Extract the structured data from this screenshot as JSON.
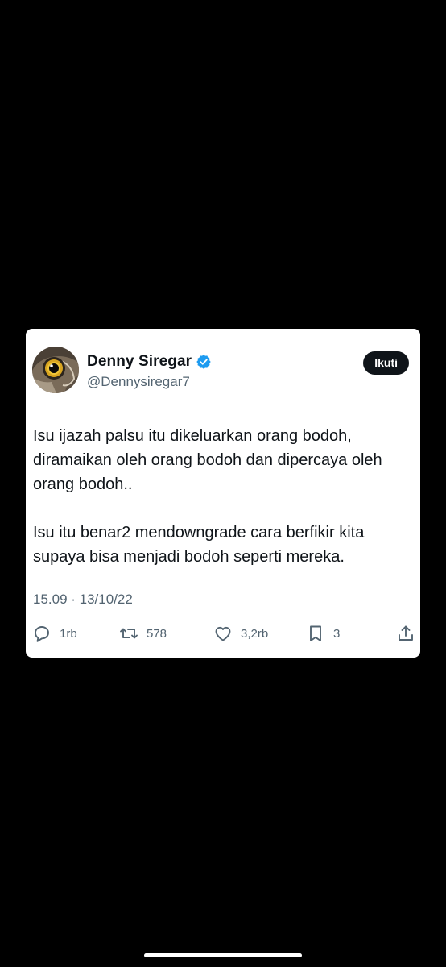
{
  "tweet": {
    "display_name": "Denny Siregar",
    "handle": "@Dennysiregar7",
    "follow_label": "Ikuti",
    "text": "Isu ijazah palsu itu dikeluarkan orang bodoh, diramaikan oleh orang bodoh dan dipercaya oleh orang bodoh..\n\nIsu itu benar2 mendowngrade cara berfikir kita supaya bisa menjadi bodoh seperti mereka.",
    "timestamp": "15.09 · 13/10/22",
    "verified_color": "#1d9bf0",
    "actions": {
      "reply": {
        "icon": "reply-icon",
        "count": "1rb"
      },
      "retweet": {
        "icon": "retweet-icon",
        "count": "578"
      },
      "like": {
        "icon": "heart-icon",
        "count": "3,2rb"
      },
      "bookmark": {
        "icon": "bookmark-icon",
        "count": "3"
      },
      "share": {
        "icon": "share-icon"
      }
    }
  }
}
